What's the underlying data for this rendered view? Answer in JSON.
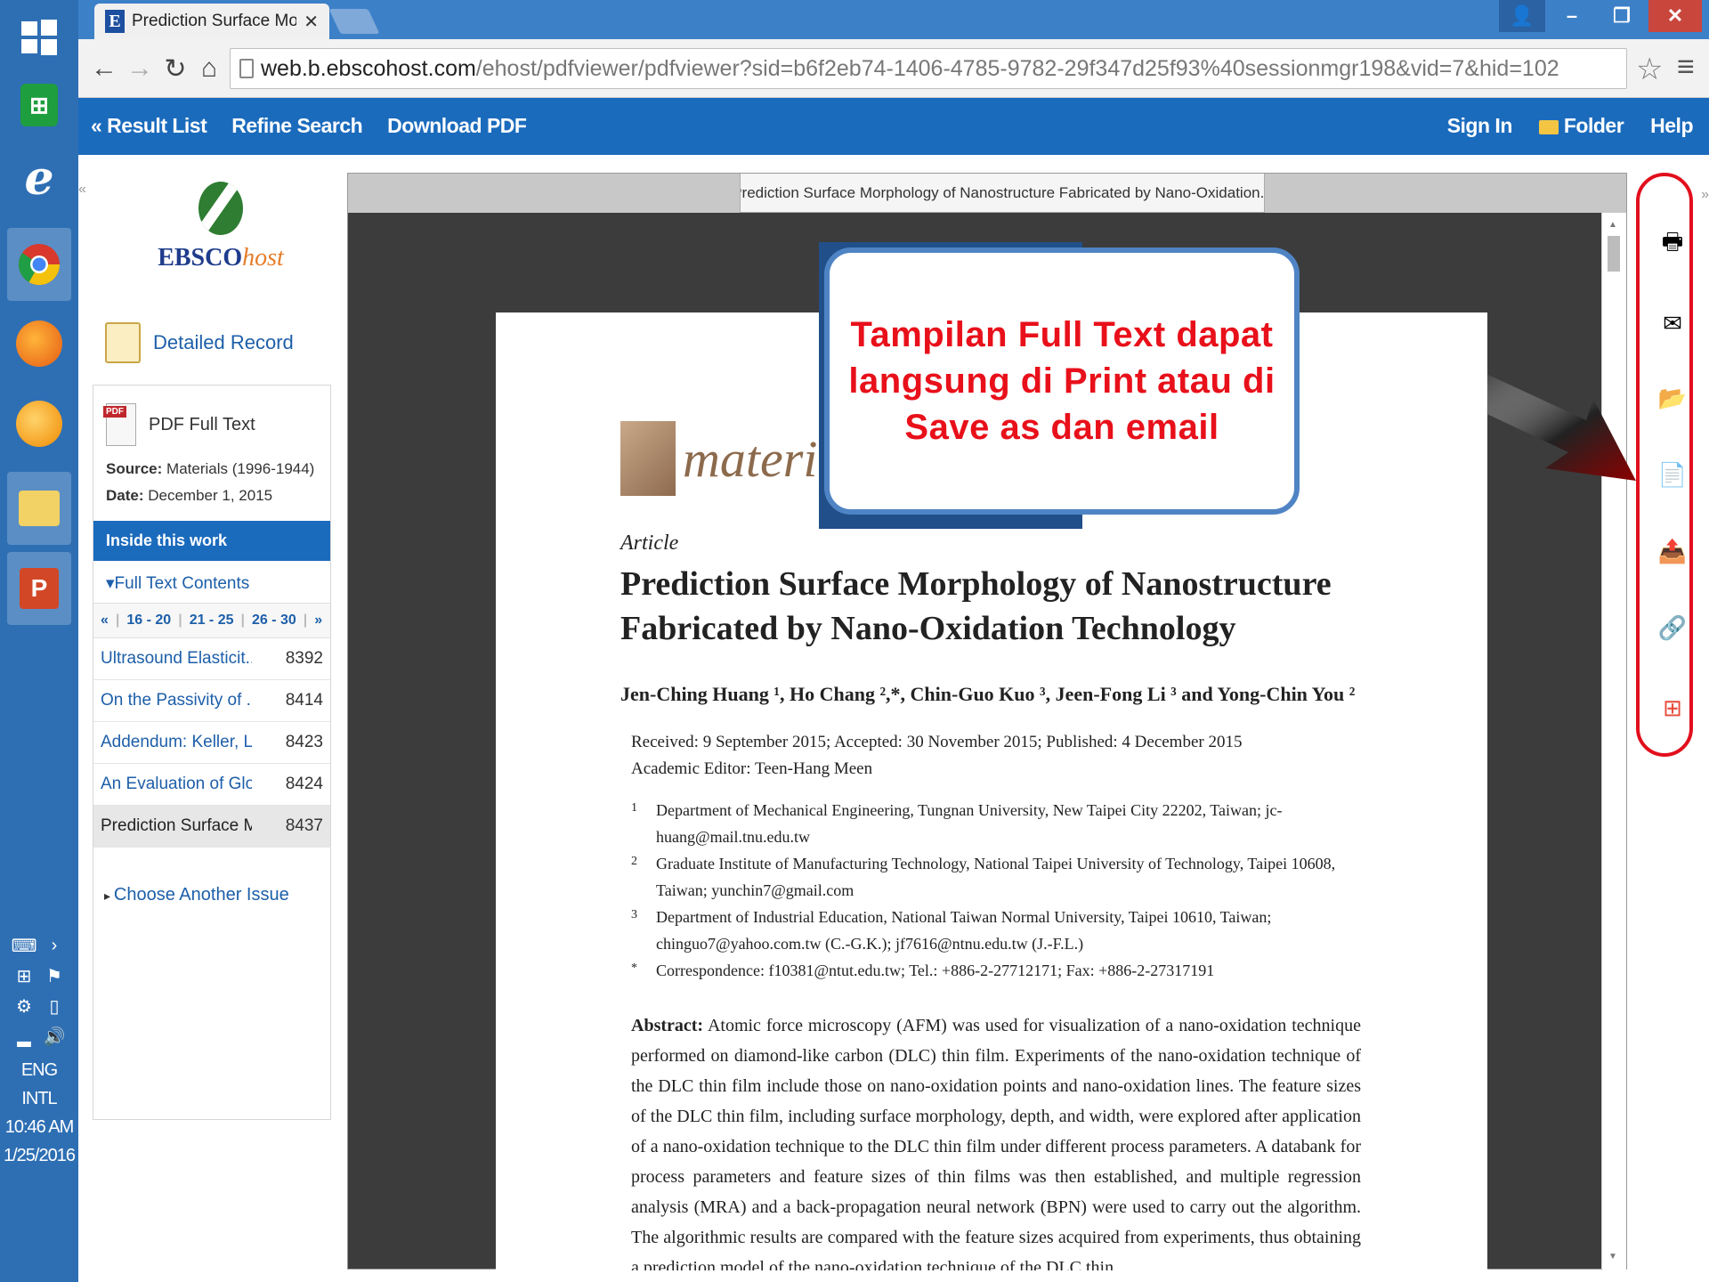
{
  "taskbar": {
    "apps": [
      {
        "icon": "start-icon",
        "active": false
      },
      {
        "icon": "store-icon",
        "active": false
      },
      {
        "icon": "internet-explorer-icon",
        "active": false
      },
      {
        "icon": "chrome-icon",
        "active": true
      },
      {
        "icon": "firefox-icon",
        "active": false
      },
      {
        "icon": "app-orb-icon",
        "active": false
      },
      {
        "icon": "file-explorer-icon",
        "active": true
      },
      {
        "icon": "powerpoint-icon",
        "active": true
      }
    ],
    "language": "ENG",
    "layout": "INTL",
    "time": "10:46 AM",
    "date": "1/25/2016"
  },
  "browser": {
    "tab_title": "Prediction Surface Morph",
    "url_host": "web.b.ebscohost.com",
    "url_path": "/ehost/pdfviewer/pdfviewer?sid=b6f2eb74-1406-4785-9782-29f347d25f93%40sessionmgr198&vid=7&hid=102"
  },
  "ebsco_bar": {
    "result_list": "« Result List",
    "refine_search": "Refine Search",
    "download_pdf": "Download PDF",
    "sign_in": "Sign In",
    "folder": "Folder",
    "help": "Help"
  },
  "sidebar": {
    "collapse": "«",
    "logo_main": "EBSCO",
    "logo_host": "host",
    "detailed_record": "Detailed Record",
    "pdf_full_text": "PDF Full Text",
    "source_label": "Source:",
    "source_value": "Materials (1996-1944)",
    "date_label": "Date:",
    "date_value": "December 1, 2015",
    "inside_work": "Inside this work",
    "full_text_contents": "Full Text Contents",
    "pager": [
      "«",
      "16 - 20",
      "21 - 25",
      "26 - 30",
      "»"
    ],
    "toc": [
      {
        "title": "Ultrasound Elasticit...",
        "page": "8392",
        "current": false
      },
      {
        "title": "On the Passivity of ...",
        "page": "8414",
        "current": false
      },
      {
        "title": "Addendum: Keller, L....",
        "page": "8423",
        "current": false
      },
      {
        "title": "An Evaluation of Glo...",
        "page": "8424",
        "current": false
      },
      {
        "title": "Prediction Surface M...",
        "page": "8437",
        "current": true
      }
    ],
    "choose_issue": "Choose Another Issue"
  },
  "viewer": {
    "doc_title": "Prediction Surface Morphology of Nanostructure Fabricated by Nano-Oxidation..."
  },
  "paper": {
    "journal": "materials",
    "kind": "Article",
    "title": "Prediction Surface Morphology of Nanostructure Fabricated by Nano-Oxidation Technology",
    "authors": "Jen-Ching Huang ¹, Ho Chang ²,*, Chin-Guo Kuo ³, Jeen-Fong Li ³ and Yong-Chin You ²",
    "received": "Received: 9 September 2015; Accepted: 30 November 2015; Published: 4 December 2015",
    "editor": "Academic Editor: Teen-Hang Meen",
    "affiliations": [
      {
        "num": "1",
        "text": "Department of Mechanical Engineering, Tungnan University, New Taipei City 22202, Taiwan; jc-huang@mail.tnu.edu.tw"
      },
      {
        "num": "2",
        "text": "Graduate Institute of Manufacturing Technology, National Taipei University of Technology, Taipei 10608, Taiwan; yunchin7@gmail.com"
      },
      {
        "num": "3",
        "text": "Department of Industrial Education, National Taiwan Normal University, Taipei 10610, Taiwan; chinguo7@yahoo.com.tw (C.-G.K.); jf7616@ntnu.edu.tw (J.-F.L.)"
      },
      {
        "num": "*",
        "text": "Correspondence: f10381@ntut.edu.tw; Tel.: +886-2-27712171; Fax: +886-2-27317191"
      }
    ],
    "abstract_label": "Abstract:",
    "abstract": "Atomic force microscopy (AFM) was used for visualization of a nano-oxidation technique performed on diamond-like carbon (DLC) thin film. Experiments of the nano-oxidation technique of the DLC thin film include those on nano-oxidation points and nano-oxidation lines. The feature sizes of the DLC thin film, including surface morphology, depth, and width, were explored after application of a nano-oxidation technique to the DLC thin film under different process parameters. A databank for process parameters and feature sizes of thin films was then established, and multiple regression analysis (MRA) and a back-propagation neural network (BPN) were used to carry out the algorithm. The algorithmic results are compared with the feature sizes acquired from experiments, thus obtaining a prediction model of the nano-oxidation technique of the DLC thin"
  },
  "callout": {
    "text": "Tampilan Full Text dapat langsung di Print atau di Save as dan email",
    "color": "#e8101a"
  },
  "tools": [
    "print-icon",
    "email-icon",
    "save-folder-icon",
    "cite-icon",
    "export-icon",
    "permalink-icon",
    "share-plus-icon"
  ],
  "colors": {
    "ebsco_blue": "#1b6bbd",
    "highlight_red": "#e20f1d"
  }
}
